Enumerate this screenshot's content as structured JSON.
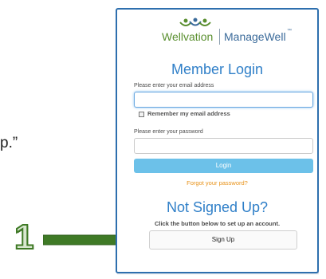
{
  "background": {
    "text_fragment": "p.”"
  },
  "callout": {
    "step_number": "1",
    "arrow_color": "#3f7a26"
  },
  "logo": {
    "brand_left": "Wellvation",
    "brand_right": "ManageWell",
    "trademark": "™",
    "left_color": "#5a8f2f",
    "right_color": "#3a6a9a"
  },
  "login": {
    "title": "Member Login",
    "email_label": "Please enter your email address",
    "email_value": "",
    "remember_label": "Remember my email address",
    "remember_checked": false,
    "password_label": "Please enter your password",
    "password_value": "",
    "login_button": "Login",
    "forgot_link": "Forgot your password?",
    "button_color": "#6cc1e9",
    "link_color": "#e8931b"
  },
  "signup": {
    "title": "Not Signed Up?",
    "hint": "Click the button below to set up an account.",
    "button": "Sign Up"
  },
  "colors": {
    "panel_border": "#2e6fae",
    "heading": "#2f7fc8"
  }
}
